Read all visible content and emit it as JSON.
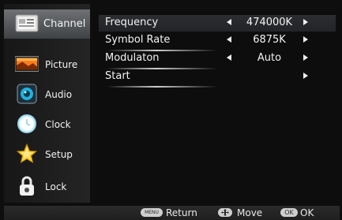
{
  "sidebar": {
    "items": [
      {
        "label": "Channel",
        "icon": "channel-icon",
        "active": true
      },
      {
        "label": "Picture",
        "icon": "picture-icon"
      },
      {
        "label": "Audio",
        "icon": "audio-icon"
      },
      {
        "label": "Clock",
        "icon": "clock-icon"
      },
      {
        "label": "Setup",
        "icon": "setup-icon"
      },
      {
        "label": "Lock",
        "icon": "lock-icon"
      }
    ]
  },
  "panel": {
    "rows": [
      {
        "name": "Frequency",
        "value": "474000K"
      },
      {
        "name": "Symbol Rate",
        "value": "6875K"
      },
      {
        "name": "Modulaton",
        "value": "Auto"
      },
      {
        "name": "Start",
        "value": ""
      }
    ]
  },
  "footer": {
    "return_key": "MENU",
    "return_label": "Return",
    "move_label": "Move",
    "ok_key": "OK",
    "ok_label": "OK"
  }
}
